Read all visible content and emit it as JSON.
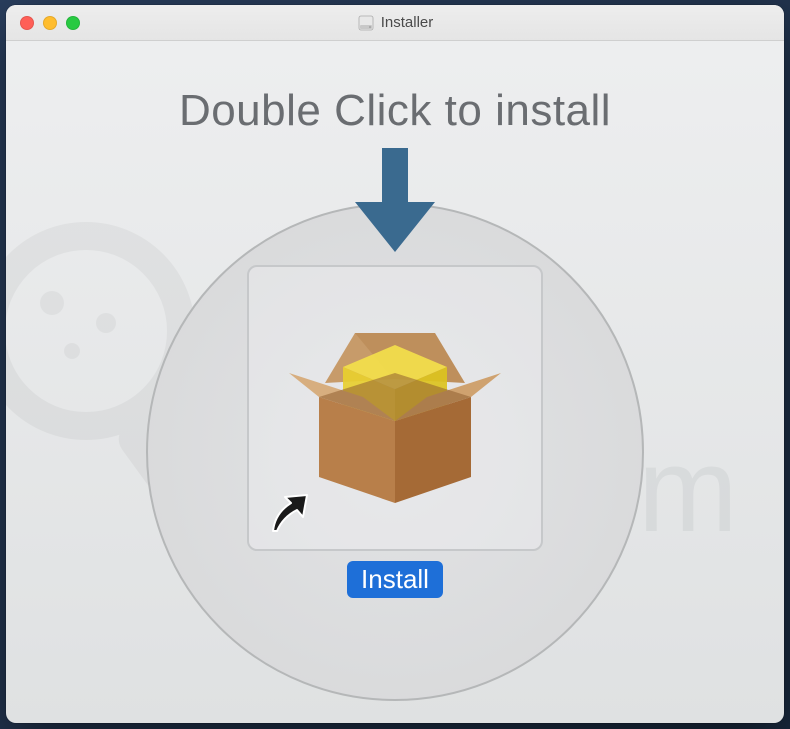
{
  "window": {
    "title": "Installer"
  },
  "content": {
    "headline": "Double Click to install",
    "install_label": "Install"
  },
  "watermark": {
    "text": "RISK.com"
  },
  "colors": {
    "accent": "#1e6fd8",
    "arrow": "#3a6a8f"
  }
}
